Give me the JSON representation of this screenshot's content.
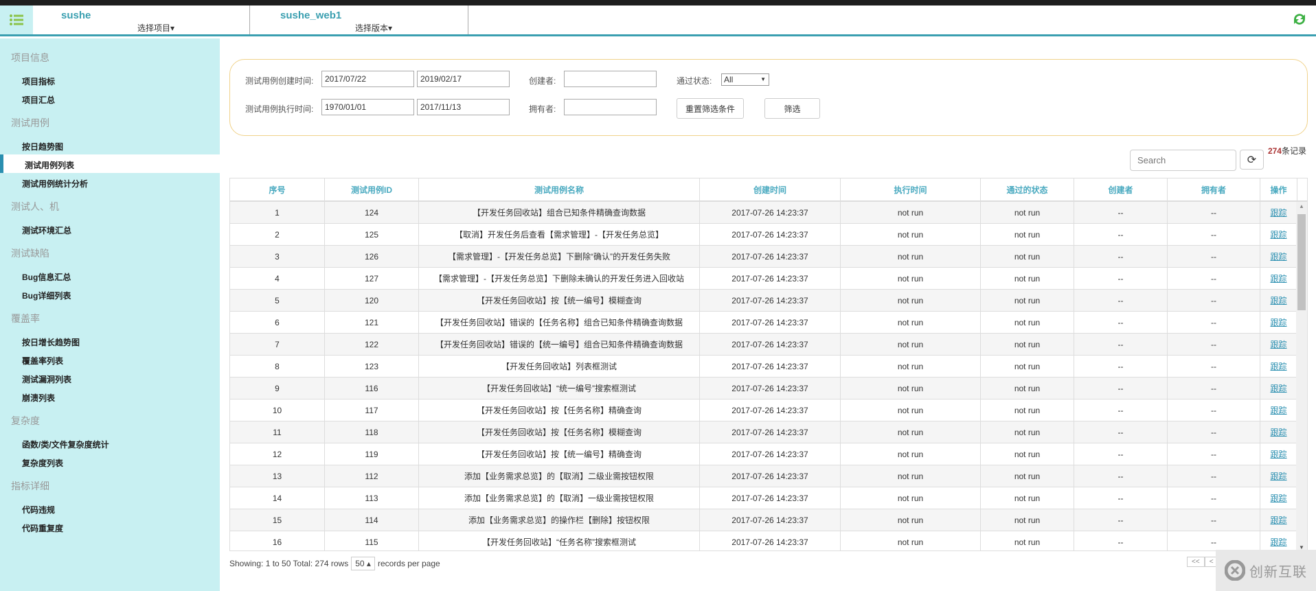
{
  "header": {
    "projects": [
      {
        "name": "sushe",
        "select": "选择项目▾"
      },
      {
        "name": "sushe_web1",
        "select": "选择版本▾"
      }
    ]
  },
  "sidebar": {
    "groups": [
      {
        "label": "项目信息",
        "items": [
          "项目指标",
          "项目汇总"
        ]
      },
      {
        "label": "测试用例",
        "items": [
          "按日趋势图",
          "测试用例列表",
          "测试用例统计分析"
        ]
      },
      {
        "label": "测试人、机",
        "items": [
          "测试环境汇总"
        ]
      },
      {
        "label": "测试缺陷",
        "items": [
          "Bug信息汇总",
          "Bug详细列表"
        ]
      },
      {
        "label": "覆盖率",
        "items": [
          "按日增长趋势图",
          "覆盖率列表",
          "测试漏洞列表",
          "崩溃列表"
        ]
      },
      {
        "label": "复杂度",
        "items": [
          "函数/类/文件复杂度统计",
          "复杂度列表"
        ]
      },
      {
        "label": "指标详细",
        "items": [
          "代码违规",
          "代码重复度"
        ]
      }
    ],
    "active": "测试用例列表"
  },
  "filter": {
    "create_time_label": "测试用例创建时间:",
    "create_from": "2017/07/22",
    "create_to": "2019/02/17",
    "exec_time_label": "测试用例执行时间:",
    "exec_from": "1970/01/01",
    "exec_to": "2017/11/13",
    "creator_label": "创建者:",
    "creator": "",
    "owner_label": "拥有者:",
    "owner": "",
    "status_label": "通过状态:",
    "status": "All",
    "reset": "重置筛选条件",
    "submit": "筛选"
  },
  "records": {
    "count": "274",
    "suffix": "条记录"
  },
  "search": {
    "placeholder": "Search"
  },
  "table": {
    "columns": [
      "序号",
      "测试用例ID",
      "测试用例名称",
      "创建时间",
      "执行时间",
      "通过的状态",
      "创建者",
      "拥有者",
      "操作"
    ],
    "rows": [
      [
        "1",
        "124",
        "【开发任务回收站】组合已知条件精确查询数据"
      ],
      [
        "2",
        "125",
        "【取消】开发任务后查看【需求管理】-【开发任务总览】"
      ],
      [
        "3",
        "126",
        "【需求管理】-【开发任务总览】下删除“确认”的开发任务失败"
      ],
      [
        "4",
        "127",
        "【需求管理】-【开发任务总览】下删除未确认的开发任务进入回收站"
      ],
      [
        "5",
        "120",
        "【开发任务回收站】按【统一编号】模糊查询"
      ],
      [
        "6",
        "121",
        "【开发任务回收站】错误的【任务名称】组合已知条件精确查询数据"
      ],
      [
        "7",
        "122",
        "【开发任务回收站】错误的【统一编号】组合已知条件精确查询数据"
      ],
      [
        "8",
        "123",
        "【开发任务回收站】列表框测试"
      ],
      [
        "9",
        "116",
        "【开发任务回收站】“统一编号”搜索框测试"
      ],
      [
        "10",
        "117",
        "【开发任务回收站】按【任务名称】精确查询"
      ],
      [
        "11",
        "118",
        "【开发任务回收站】按【任务名称】模糊查询"
      ],
      [
        "12",
        "119",
        "【开发任务回收站】按【统一编号】精确查询"
      ],
      [
        "13",
        "112",
        "添加【业务需求总览】的【取消】二级业需按钮权限"
      ],
      [
        "14",
        "113",
        "添加【业务需求总览】的【取消】一级业需按钮权限"
      ],
      [
        "15",
        "114",
        "添加【业务需求总览】的操作栏【删除】按钮权限"
      ],
      [
        "16",
        "115",
        "【开发任务回收站】“任务名称”搜索框测试"
      ]
    ],
    "created": "2017-07-26 14:23:37",
    "exec": "not run",
    "status": "not run",
    "creator": "--",
    "owner": "--",
    "action": "跟踪"
  },
  "footer": {
    "showing": "Showing: 1 to 50 Total: 274 rows",
    "per_page": "50 ▴",
    "per_page_suffix": "records per page",
    "first": "<<",
    "prev": "<"
  },
  "watermark": {
    "text": "创新互联"
  },
  "colors": {
    "accent": "#3a9fb0",
    "sidebar": "#c8f0f2",
    "header_text": "#4aaac0"
  }
}
